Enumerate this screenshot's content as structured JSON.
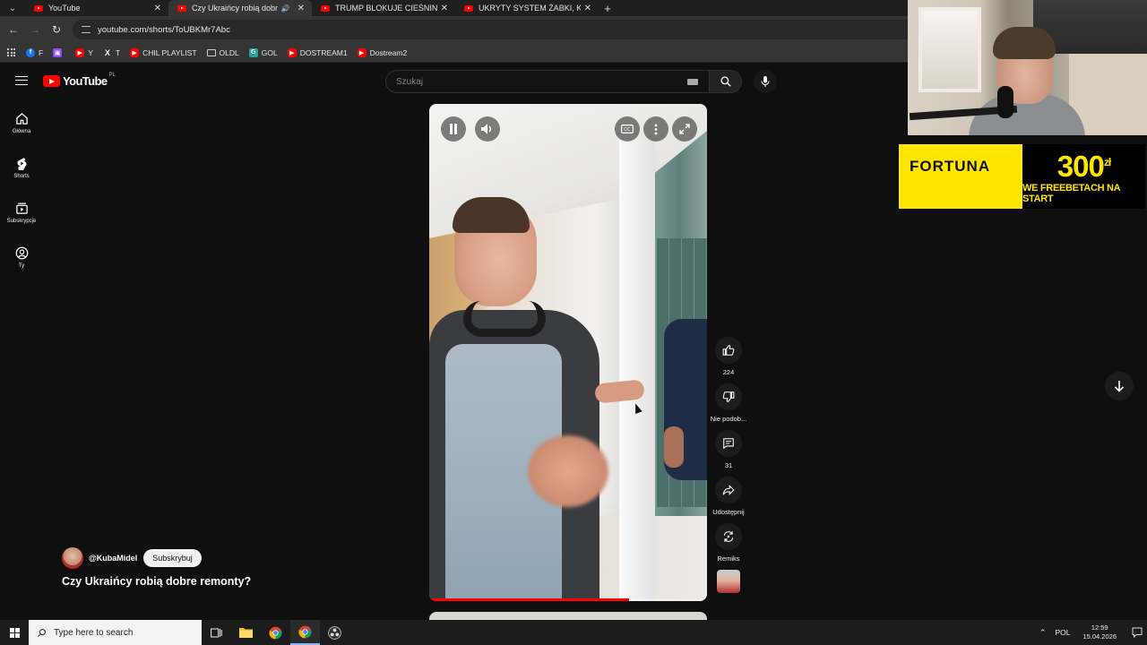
{
  "browser": {
    "tabs": [
      {
        "title": "YouTube",
        "active": false,
        "audio": false
      },
      {
        "title": "Czy Ukraińcy robią dobre r",
        "active": true,
        "audio": true
      },
      {
        "title": "TRUMP BLOKUJE CIEŚNINĘ, ale",
        "active": false,
        "audio": false
      },
      {
        "title": "UKRYTY SYSTEM ŻABKI, KTÓRY",
        "active": false,
        "audio": false
      }
    ],
    "url": "youtube.com/shorts/ToUBKMr7Abc",
    "bookmarks": [
      {
        "label": "F",
        "icon_color": "#1877f2",
        "icon_text": "f"
      },
      {
        "label": "",
        "icon_color": "#9146ff",
        "icon_text": "▣"
      },
      {
        "label": "Y",
        "icon_color": "#ff0000",
        "icon_text": "▶"
      },
      {
        "label": "T",
        "icon_color": "#000000",
        "icon_text": "X"
      },
      {
        "label": "CHIL PLAYLIST",
        "icon_color": "#ff0000",
        "icon_text": "▶"
      },
      {
        "label": "OLDL",
        "icon_color": "folder",
        "icon_text": ""
      },
      {
        "label": "GOL",
        "icon_color": "#2aa198",
        "icon_text": "G"
      },
      {
        "label": "DOSTREAM1",
        "icon_color": "#ff0000",
        "icon_text": "▶"
      },
      {
        "label": "Dostream2",
        "icon_color": "#ff0000",
        "icon_text": "▶"
      }
    ]
  },
  "youtube": {
    "logo_text": "YouTube",
    "region": "PL",
    "search_placeholder": "Szukaj",
    "sidebar": [
      {
        "label": "Główna",
        "icon": "home-icon"
      },
      {
        "label": "Shorts",
        "icon": "shorts-icon"
      },
      {
        "label": "Subskrypcje",
        "icon": "subscriptions-icon"
      },
      {
        "label": "Ty",
        "icon": "profile-icon"
      }
    ],
    "short": {
      "channel_handle": "@KubaMidel",
      "subscribe_label": "Subskrybuj",
      "title": "Czy Ukraińcy robią dobre remonty?",
      "progress": 0.72
    },
    "actions": {
      "likes": "224",
      "dislike_label": "Nie podob...",
      "comments": "31",
      "share_label": "Udostępnij",
      "remix_label": "Remiks"
    }
  },
  "ad": {
    "brand": "FORTUNA",
    "amount": "300",
    "currency": "zł",
    "tagline": "WE FREEBETACH NA START",
    "brand_color": "#ffe600"
  },
  "taskbar": {
    "search_placeholder": "Type here to search",
    "language": "POL",
    "time": "12:59",
    "date": "15.04.2026"
  }
}
